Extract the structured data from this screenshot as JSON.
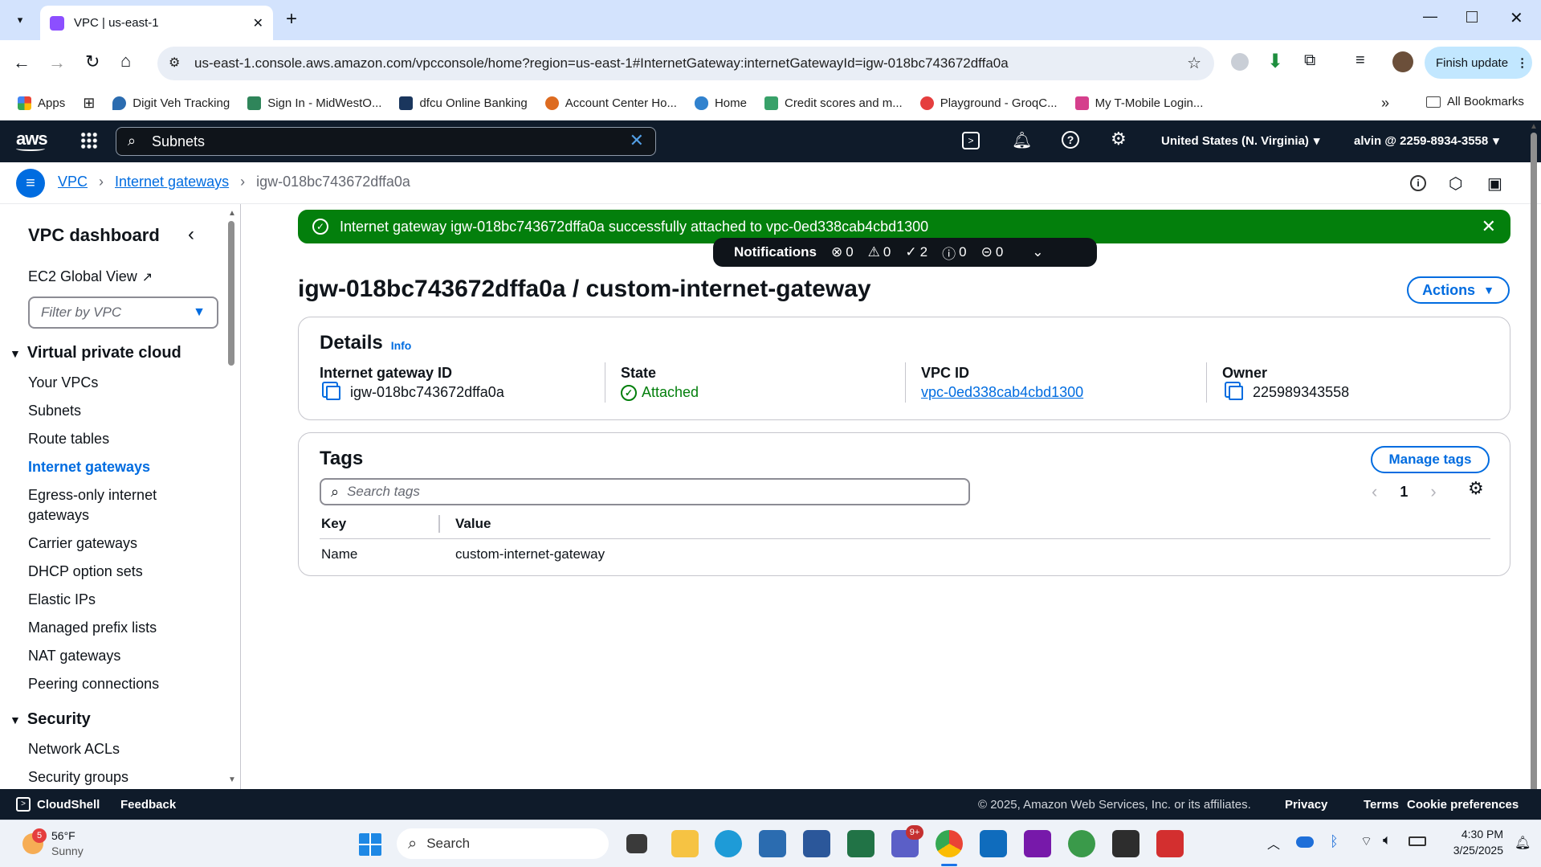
{
  "browser": {
    "tab_title": "VPC | us-east-1",
    "url": "us-east-1.console.aws.amazon.com/vpcconsole/home?region=us-east-1#InternetGateway:internetGatewayId=igw-018bc743672dffa0a",
    "finish_update": "Finish update",
    "bookmarks": [
      {
        "label": "Apps",
        "color": "#4285f4"
      },
      {
        "label": "Digit Veh Tracking",
        "color": "#2b6cb0"
      },
      {
        "label": "Sign In - MidWestO...",
        "color": "#2f855a"
      },
      {
        "label": "dfcu Online Banking",
        "color": "#1a365d"
      },
      {
        "label": "Account Center Ho...",
        "color": "#dd6b20"
      },
      {
        "label": "Home",
        "color": "#3182ce"
      },
      {
        "label": "Credit scores and m...",
        "color": "#38a169"
      },
      {
        "label": "Playground - GroqC...",
        "color": "#e53e3e"
      },
      {
        "label": "My T-Mobile Login...",
        "color": "#d53f8c"
      }
    ],
    "all_bookmarks": "All Bookmarks"
  },
  "aws": {
    "logo": "aws",
    "search_value": "Subnets",
    "region": "United States (N. Virginia)",
    "account": "alvin @ 2259-8934-3558"
  },
  "breadcrumb": {
    "items": [
      "VPC",
      "Internet gateways"
    ],
    "current": "igw-018bc743672dffa0a"
  },
  "sidebar": {
    "title": "VPC dashboard",
    "ec2_global_view": "EC2 Global View",
    "filter_placeholder": "Filter by VPC",
    "section_vpc": "Virtual private cloud",
    "items": [
      "Your VPCs",
      "Subnets",
      "Route tables",
      "Internet gateways",
      "Egress-only internet",
      "gateways",
      "Carrier gateways",
      "DHCP option sets",
      "Elastic IPs",
      "Managed prefix lists",
      "NAT gateways",
      "Peering connections"
    ],
    "section_security": "Security",
    "security_items": [
      "Network ACLs",
      "Security groups"
    ]
  },
  "flash": {
    "message": "Internet gateway igw-018bc743672dffa0a successfully attached to vpc-0ed338cab4cbd1300",
    "notifications_label": "Notifications",
    "counts": {
      "error": "0",
      "warning": "0",
      "success": "2",
      "info": "0",
      "in_progress": "0"
    },
    "color": "#037f0c"
  },
  "page": {
    "title": "igw-018bc743672dffa0a / custom-internet-gateway",
    "actions": "Actions"
  },
  "details": {
    "heading": "Details",
    "info": "Info",
    "fields": {
      "igw_label": "Internet gateway ID",
      "igw_value": "igw-018bc743672dffa0a",
      "state_label": "State",
      "state_value": "Attached",
      "vpc_label": "VPC ID",
      "vpc_value": "vpc-0ed338cab4cbd1300",
      "owner_label": "Owner",
      "owner_value": "225989343558"
    }
  },
  "tags": {
    "heading": "Tags",
    "manage": "Manage tags",
    "search_placeholder": "Search tags",
    "page": "1",
    "columns": [
      "Key",
      "Value"
    ],
    "rows": [
      [
        "Name",
        "custom-internet-gateway"
      ]
    ]
  },
  "footer": {
    "cloudshell": "CloudShell",
    "feedback": "Feedback",
    "copyright": "© 2025, Amazon Web Services, Inc. or its affiliates.",
    "privacy": "Privacy",
    "terms": "Terms",
    "cookies": "Cookie preferences"
  },
  "taskbar": {
    "weather_temp": "56°F",
    "weather_desc": "Sunny",
    "weather_badge": "5",
    "search": "Search",
    "teams_badge": "9+",
    "time": "4:30 PM",
    "date": "3/25/2025"
  }
}
